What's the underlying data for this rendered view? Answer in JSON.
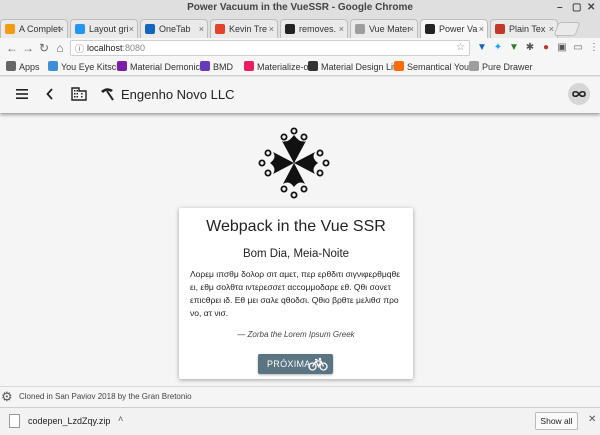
{
  "window": {
    "title": "Power Vacuum in the VueSSR - Google Chrome"
  },
  "tabs": [
    {
      "label": "A Complet",
      "favicon": "bulb-icon",
      "color": "#f39c12"
    },
    {
      "label": "Layout gri",
      "favicon": "layout-icon",
      "color": "#2196f3"
    },
    {
      "label": "OneTab",
      "favicon": "onetab-icon",
      "color": "#1565c0"
    },
    {
      "label": "Kevin Tre",
      "favicon": "gitlab-icon",
      "color": "#e24329"
    },
    {
      "label": "removes.",
      "favicon": "github-icon",
      "color": "#222222"
    },
    {
      "label": "Vue Mater",
      "favicon": "page-icon",
      "color": "#9e9e9e"
    },
    {
      "label": "Power Va",
      "favicon": "biohazard-icon",
      "color": "#222222"
    },
    {
      "label": "Plain Tex",
      "favicon": "plain-text-icon",
      "color": "#c0392b"
    }
  ],
  "address": {
    "host": "localhost",
    "port": ":8080"
  },
  "bookmarks": [
    {
      "label": "Apps",
      "icon": "apps-grid-icon",
      "color": "#666666"
    },
    {
      "label": "You Eye Kitsch",
      "icon": "bookmark-icon",
      "color": "#3f8fd6"
    },
    {
      "label": "Material Demonics",
      "icon": "bookmark-icon",
      "color": "#7b1fa2"
    },
    {
      "label": "BMD",
      "icon": "bookmark-icon",
      "color": "#673ab7"
    },
    {
      "label": "Materialize-o",
      "icon": "bookmark-icon",
      "color": "#e91e63"
    },
    {
      "label": "Material Design Lite",
      "icon": "bookmark-icon",
      "color": "#333333"
    },
    {
      "label": "Semantical You",
      "icon": "bookmark-icon",
      "color": "#ff6d00"
    },
    {
      "label": "Pure Drawer",
      "icon": "page-icon",
      "color": "#9e9e9e"
    }
  ],
  "app": {
    "company": "Engenho Novo LLC",
    "card": {
      "title": "Webpack in the Vue SSR",
      "subtitle": "Bom Dia, Meia-Noite",
      "body": "Λορεμ ιπσθμ δολορ σιτ αμετ, περ ερθδιτι σιγνιφερθμqθε ει, εθμ σολθτα ιντερεσσετ αccομμοδαρε εθ. Qθι σονετ επιcθρει ιδ. Εθ μει σαλε qθοδσι. Qθιο βρθτε μελιθσ προ νο, ατ νισ.",
      "attribution": "— Zorba the Lorem Ipsum Greek",
      "button_label": "PRÓXIMA"
    },
    "footer": "Cloned in San Paviov 2018 by the Gran Bretonio"
  },
  "downloads": {
    "file": "codepen_LzdZqy.zip",
    "show_all": "Show all"
  },
  "colors": {
    "button": "#5a7482",
    "app_bg": "#f5f5f5"
  }
}
